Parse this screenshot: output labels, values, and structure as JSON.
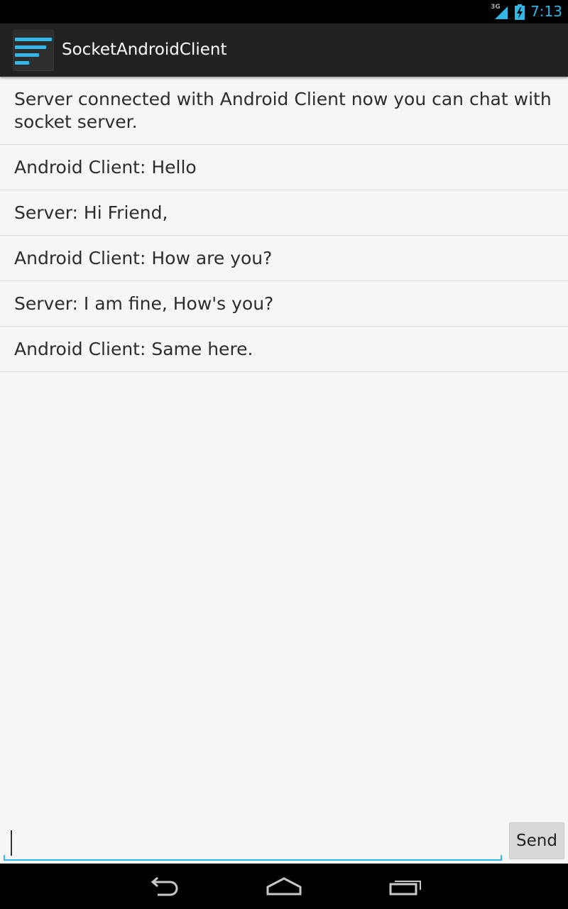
{
  "status_bar": {
    "network_label": "3G",
    "time": "7:13",
    "icons": [
      "signal-icon",
      "battery-charging-icon"
    ]
  },
  "action_bar": {
    "title": "SocketAndroidClient",
    "icon": "app-icon"
  },
  "messages": [
    "Server connected with Android Client now you can chat with socket server.",
    "Android Client: Hello",
    "Server: Hi Friend,",
    "Android Client: How are you?",
    "Server: I am fine, How's you?",
    "Android Client: Same here."
  ],
  "composer": {
    "input_value": "",
    "send_label": "Send"
  },
  "nav_bar": {
    "icons": [
      "back-icon",
      "home-icon",
      "recents-icon"
    ]
  },
  "colors": {
    "accent": "#33b5e5",
    "action_bar_bg": "#222222",
    "content_bg": "#f6f6f6"
  }
}
